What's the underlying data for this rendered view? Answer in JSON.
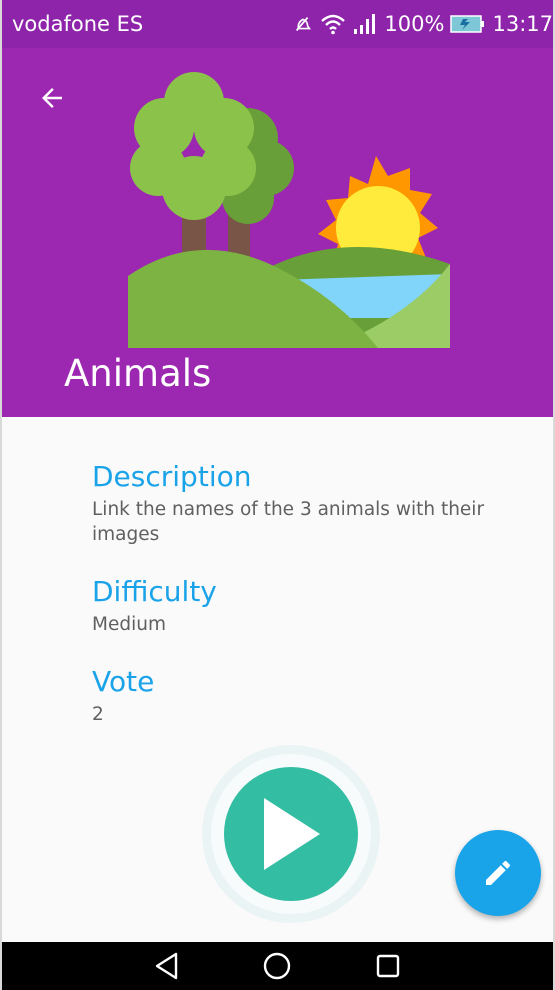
{
  "status_bar": {
    "carrier": "vodafone ES",
    "battery": "100%",
    "time": "13:17"
  },
  "header": {
    "title": "Animals",
    "color": "#9c27b0"
  },
  "details": {
    "description_label": "Description",
    "description_value": "Link the names of the 3 animals with their images",
    "difficulty_label": "Difficulty",
    "difficulty_value": "Medium",
    "vote_label": "Vote",
    "vote_value": "2"
  },
  "icons": {
    "back": "arrow-left-icon",
    "play": "play-icon",
    "edit": "pencil-icon",
    "nav_back": "triangle-back-icon",
    "nav_home": "circle-home-icon",
    "nav_recent": "square-recent-icon"
  },
  "colors": {
    "accent": "#1aa3e8",
    "play": "#33bda3",
    "fab": "#19a4ea"
  }
}
